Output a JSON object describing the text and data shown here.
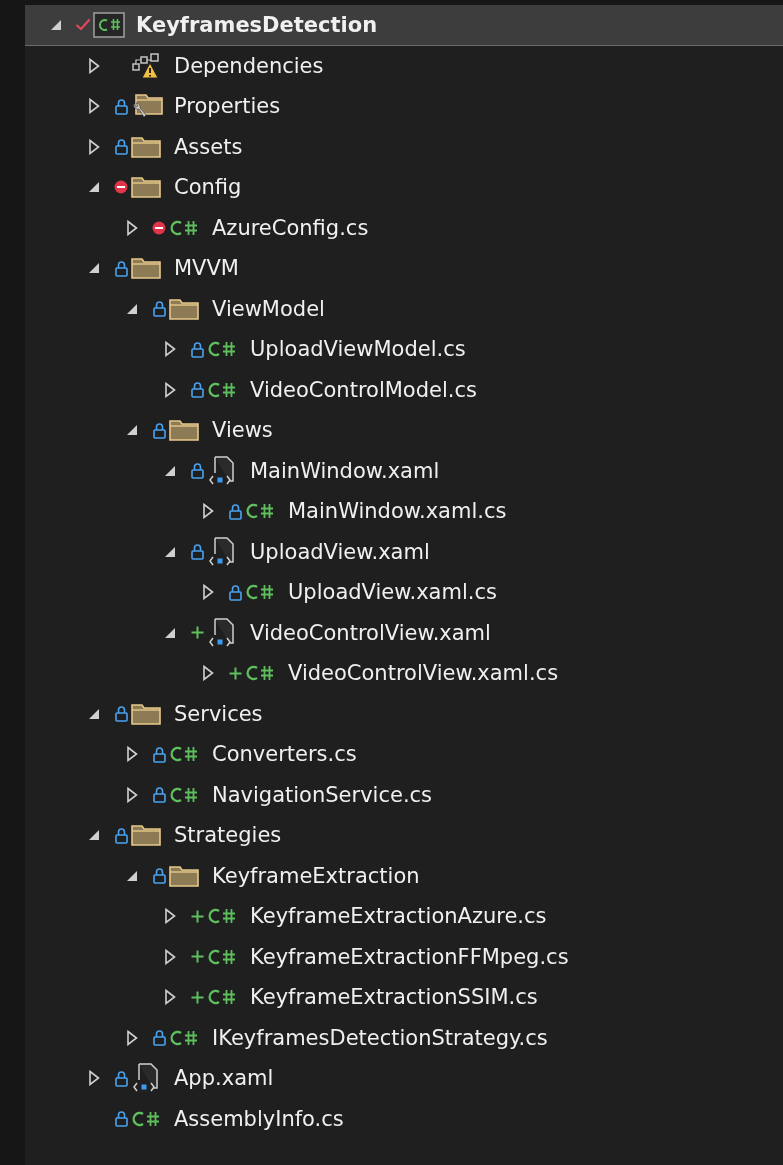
{
  "solution_explorer": {
    "project": {
      "label": "KeyframesDetection",
      "kind": "project",
      "overlay": {
        "kind": "check"
      },
      "selected": true,
      "expanded": true,
      "children": [
        {
          "label": "Dependencies",
          "kind": "dependencies",
          "expanded": false
        },
        {
          "label": "Properties",
          "kind": "properties",
          "overlay": {
            "kind": "lock"
          },
          "expanded": false
        },
        {
          "label": "Assets",
          "kind": "folder",
          "overlay": {
            "kind": "lock"
          },
          "expanded": false
        },
        {
          "label": "Config",
          "kind": "folder",
          "overlay": {
            "kind": "excluded"
          },
          "expanded": true,
          "children": [
            {
              "label": "AzureConfig.cs",
              "kind": "csharp",
              "overlay": {
                "kind": "excluded"
              },
              "expanded": false
            }
          ]
        },
        {
          "label": "MVVM",
          "kind": "folder",
          "overlay": {
            "kind": "lock"
          },
          "expanded": true,
          "children": [
            {
              "label": "ViewModel",
              "kind": "folder",
              "overlay": {
                "kind": "lock"
              },
              "expanded": true,
              "children": [
                {
                  "label": "UploadViewModel.cs",
                  "kind": "csharp",
                  "overlay": {
                    "kind": "lock"
                  },
                  "expanded": false
                },
                {
                  "label": "VideoControlModel.cs",
                  "kind": "csharp",
                  "overlay": {
                    "kind": "lock"
                  },
                  "expanded": false
                }
              ]
            },
            {
              "label": "Views",
              "kind": "folder",
              "overlay": {
                "kind": "lock"
              },
              "expanded": true,
              "children": [
                {
                  "label": "MainWindow.xaml",
                  "kind": "xaml",
                  "overlay": {
                    "kind": "lock"
                  },
                  "expanded": true,
                  "children": [
                    {
                      "label": "MainWindow.xaml.cs",
                      "kind": "csharp",
                      "overlay": {
                        "kind": "lock"
                      },
                      "expanded": false
                    }
                  ]
                },
                {
                  "label": "UploadView.xaml",
                  "kind": "xaml",
                  "overlay": {
                    "kind": "lock"
                  },
                  "expanded": true,
                  "children": [
                    {
                      "label": "UploadView.xaml.cs",
                      "kind": "csharp",
                      "overlay": {
                        "kind": "lock"
                      },
                      "expanded": false
                    }
                  ]
                },
                {
                  "label": "VideoControlView.xaml",
                  "kind": "xaml",
                  "overlay": {
                    "kind": "added"
                  },
                  "expanded": true,
                  "children": [
                    {
                      "label": "VideoControlView.xaml.cs",
                      "kind": "csharp",
                      "overlay": {
                        "kind": "added"
                      },
                      "expanded": false
                    }
                  ]
                }
              ]
            }
          ]
        },
        {
          "label": "Services",
          "kind": "folder",
          "overlay": {
            "kind": "lock"
          },
          "expanded": true,
          "children": [
            {
              "label": "Converters.cs",
              "kind": "csharp",
              "overlay": {
                "kind": "lock"
              },
              "expanded": false
            },
            {
              "label": "NavigationService.cs",
              "kind": "csharp",
              "overlay": {
                "kind": "lock"
              },
              "expanded": false
            }
          ]
        },
        {
          "label": "Strategies",
          "kind": "folder",
          "overlay": {
            "kind": "lock"
          },
          "expanded": true,
          "children": [
            {
              "label": "KeyframeExtraction",
              "kind": "folder",
              "overlay": {
                "kind": "lock"
              },
              "expanded": true,
              "children": [
                {
                  "label": "KeyframeExtractionAzure.cs",
                  "kind": "csharp",
                  "overlay": {
                    "kind": "added"
                  },
                  "expanded": false
                },
                {
                  "label": "KeyframeExtractionFFMpeg.cs",
                  "kind": "csharp",
                  "overlay": {
                    "kind": "added"
                  },
                  "expanded": false
                },
                {
                  "label": "KeyframeExtractionSSIM.cs",
                  "kind": "csharp",
                  "overlay": {
                    "kind": "added"
                  },
                  "expanded": false
                }
              ]
            },
            {
              "label": "IKeyframesDetectionStrategy.cs",
              "kind": "csharp",
              "overlay": {
                "kind": "lock"
              },
              "expanded": false
            }
          ]
        },
        {
          "label": "App.xaml",
          "kind": "xaml",
          "overlay": {
            "kind": "lock"
          },
          "expanded": false
        },
        {
          "label": "AssemblyInfo.cs",
          "kind": "csharp",
          "overlay": {
            "kind": "lock"
          }
        }
      ]
    }
  }
}
